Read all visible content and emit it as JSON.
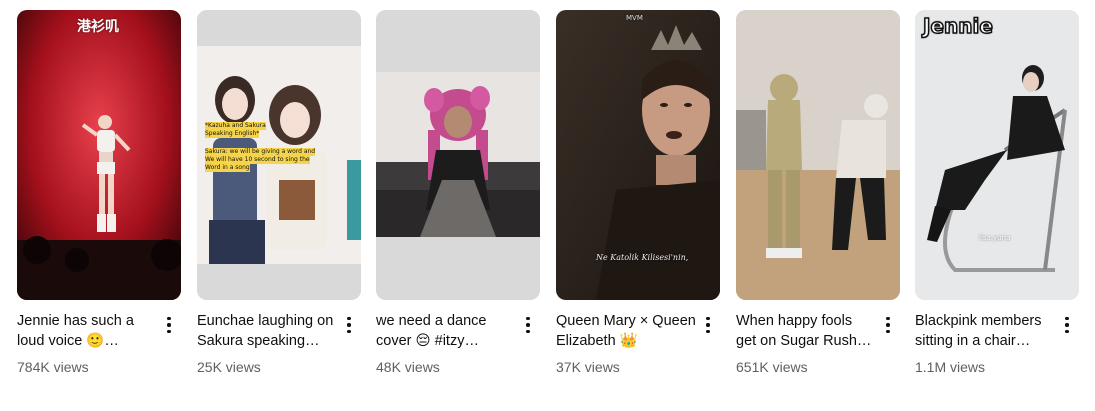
{
  "shorts": [
    {
      "title": "Jennie has such a loud voice 🙂 #jenni…",
      "views": "784K views",
      "overlay": "港衫叽",
      "thumb_bg": "#b01522"
    },
    {
      "title": "Eunchae laughing on Sakura speaking…",
      "views": "25K views",
      "overlay_lines": [
        "*Kazuha and Sakura",
        "Speaking English*",
        "Sakura: we will be giving a word and",
        "We will have 10 second to sing the",
        "Word in a song"
      ],
      "thumb_bg": "#d9d9d9"
    },
    {
      "title": "we need a dance cover 😔 #itzy…",
      "views": "48K views",
      "thumb_bg": "#d9d9d9"
    },
    {
      "title": "Queen Mary × Queen Elizabeth 👑",
      "views": "37K views",
      "overlay": "MVM",
      "caption": "Ne Katolik Kilisesi'nin,",
      "thumb_bg": "#2a211b"
    },
    {
      "title": "When happy fools get on Sugar Rush Ride…",
      "views": "651K views",
      "thumb_bg": "#c9bfb3"
    },
    {
      "title": "Blackpink members sitting in a chair…",
      "views": "1.1M views",
      "overlay": "Jennie",
      "watermark": "lisa.yuna",
      "thumb_bg": "#e6e8ea"
    }
  ],
  "icons": {
    "more": "three-dots-vertical-icon"
  }
}
